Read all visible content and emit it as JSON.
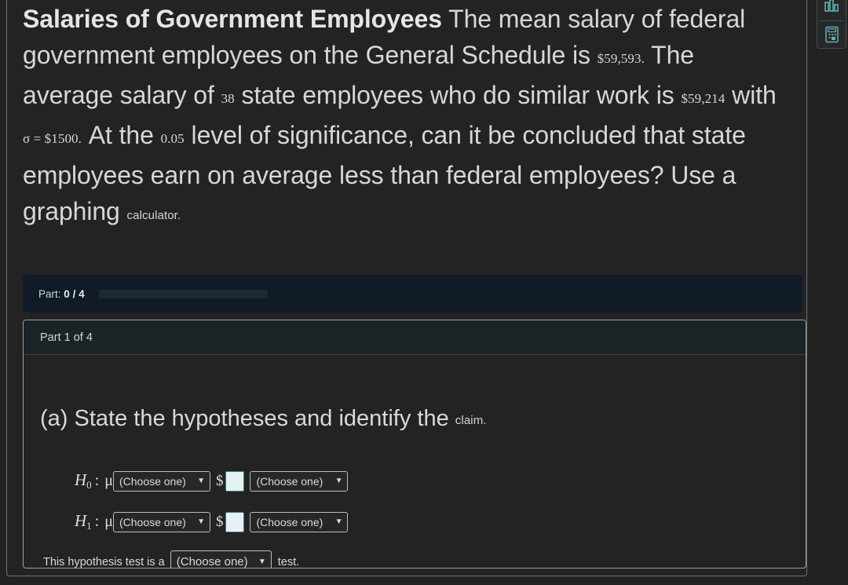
{
  "question": {
    "title": "Salaries of Government Employees",
    "segments": [
      {
        "type": "text",
        "value": " The mean salary of federal government employees on the General Schedule is "
      },
      {
        "type": "math",
        "value": "$59,593."
      },
      {
        "type": "text",
        "value": " The average salary of "
      },
      {
        "type": "math",
        "value": "38"
      },
      {
        "type": "text",
        "value": " state employees who do similar work is "
      },
      {
        "type": "math",
        "value": "$59,214"
      },
      {
        "type": "text",
        "value": " with "
      },
      {
        "type": "math",
        "value": "σ = $1500."
      },
      {
        "type": "text",
        "value": " At the "
      },
      {
        "type": "math",
        "value": "0.05"
      },
      {
        "type": "text",
        "value": " level of significance, can it be concluded that state employees earn on average less than federal employees? Use a graphing "
      },
      {
        "type": "small",
        "value": "calculator."
      }
    ],
    "mean_federal_salary": "$59,593.",
    "sample_size": "38",
    "mean_state_salary": "$59,214",
    "sigma": "σ = $1500.",
    "alpha": "0.05",
    "trailing_word": "calculator."
  },
  "progress": {
    "label_prefix": "Part:",
    "completed": "0",
    "separator": "/",
    "total": "4",
    "label_full": "Part: 0 / 4",
    "percent": 0,
    "bar_color": "#2d6fb8",
    "strip_background": "#101b27"
  },
  "part_card": {
    "header": "Part 1 of 4",
    "prompt_main": "(a) State the hypotheses and identify the",
    "prompt_trailing": "claim.",
    "hypotheses": [
      {
        "name": "H0",
        "label": "H",
        "subscript": "0",
        "colon": ":",
        "mu": "μ",
        "comparator_select": "(Choose one)",
        "currency": "$",
        "value_input": "",
        "value_placeholder": "",
        "claim_select": "(Choose one)"
      },
      {
        "name": "H1",
        "label": "H",
        "subscript": "1",
        "colon": ":",
        "mu": "μ",
        "comparator_select": "(Choose one)",
        "currency": "$",
        "value_input": "",
        "value_placeholder": "",
        "claim_select": "(Choose one)"
      }
    ],
    "test_type": {
      "lead_text": "This hypothesis test is a",
      "select_value": "(Choose one)",
      "trail_text": "test."
    },
    "caret_glyph": "▼"
  },
  "tool_rail": {
    "buttons": [
      {
        "name": "bar-chart-icon",
        "tooltip": "Statistics"
      },
      {
        "name": "calculator-icon",
        "tooltip": "Calculator"
      }
    ]
  },
  "theme": {
    "page_background": "#222222",
    "card_background": "#232323",
    "text_color": "#d9dadb",
    "input_fill": "#e3f2f5",
    "input_border": "#3f7f86",
    "accent_teal": "#4fb3bf"
  }
}
